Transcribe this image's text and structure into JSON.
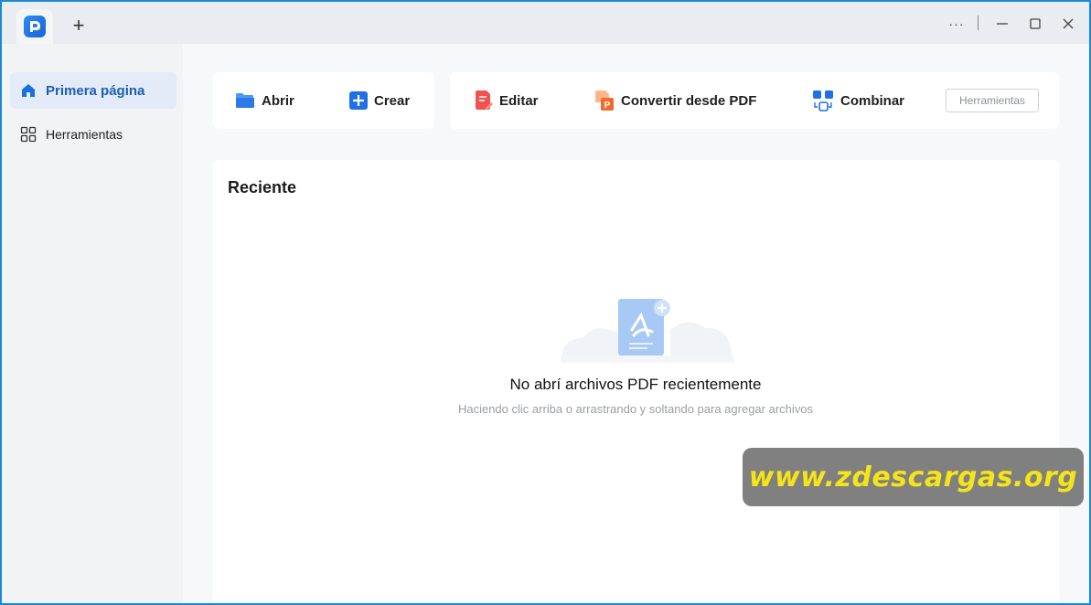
{
  "titlebar": {
    "new_tab": "+",
    "more": "···",
    "minimize": "—",
    "maximize": "☐",
    "close": "✕"
  },
  "sidebar": {
    "items": [
      {
        "label": "Primera página",
        "icon": "home-icon",
        "active": true
      },
      {
        "label": "Herramientas",
        "icon": "grid-icon",
        "active": false
      }
    ]
  },
  "toolbar": {
    "open_label": "Abrir",
    "create_label": "Crear",
    "edit_label": "Editar",
    "convert_label": "Convertir desde PDF",
    "combine_label": "Combinar",
    "tools_label": "Herramientas"
  },
  "recent": {
    "title": "Reciente",
    "empty_title": "No abrí archivos PDF recientemente",
    "empty_subtitle": "Haciendo clic arriba o arrastrando y soltando para agregar archivos"
  },
  "watermark": {
    "text": "www.zdescargas.org"
  },
  "colors": {
    "accent": "#1a5fb4",
    "frame": "#1e88d8",
    "watermark_text": "#f5e418"
  }
}
